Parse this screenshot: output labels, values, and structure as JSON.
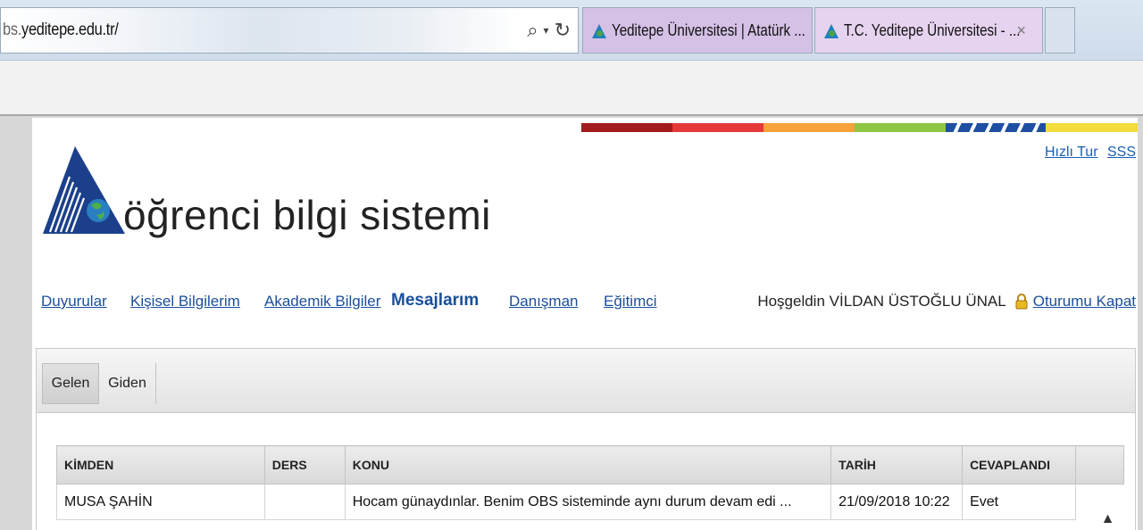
{
  "browser": {
    "url_prefix": "bs.",
    "url_host": "yeditepe.edu.tr/",
    "tabs": [
      {
        "title": "Yeditepe Üniversitesi | Atatürk ..."
      },
      {
        "title": "T.C. Yeditepe Üniversitesi - ...",
        "close": "×"
      }
    ],
    "search_glyph": "⌕",
    "refresh_glyph": "↻"
  },
  "header": {
    "logo_text": "öğrenci bilgi sistemi",
    "links": [
      "Hızlı Tur",
      "SSS"
    ]
  },
  "nav": {
    "items": [
      {
        "label": "Duyurular"
      },
      {
        "label": "Kişisel Bilgilerim"
      },
      {
        "label": "Akademik Bilgiler"
      },
      {
        "label": "Mesajlarım",
        "active": true
      },
      {
        "label": "Danışman"
      },
      {
        "label": "Eğitimci"
      }
    ],
    "welcome": "Hoşgeldin VİLDAN ÜSTOĞLU ÜNAL",
    "logout": "Oturumu Kapat"
  },
  "messages": {
    "tabs": [
      "Gelen",
      "Giden"
    ],
    "columns": [
      "KİMDEN",
      "DERS",
      "KONU",
      "TARİH",
      "CEVAPLANDI"
    ],
    "rows": [
      {
        "kimden": "MUSA ŞAHİN",
        "ders": "",
        "konu": "Hocam günaydınlar. Benim OBS sisteminde aynı durum devam edi ...",
        "tarih": "21/09/2018 10:22",
        "cevaplandi": "Evet"
      }
    ]
  },
  "colors": {
    "link": "#1a4f9c",
    "strip": [
      "#a21b1b",
      "#e53838",
      "#f7a23a",
      "#8fc642",
      "#1f4fa3",
      "#f3dc3c"
    ]
  }
}
